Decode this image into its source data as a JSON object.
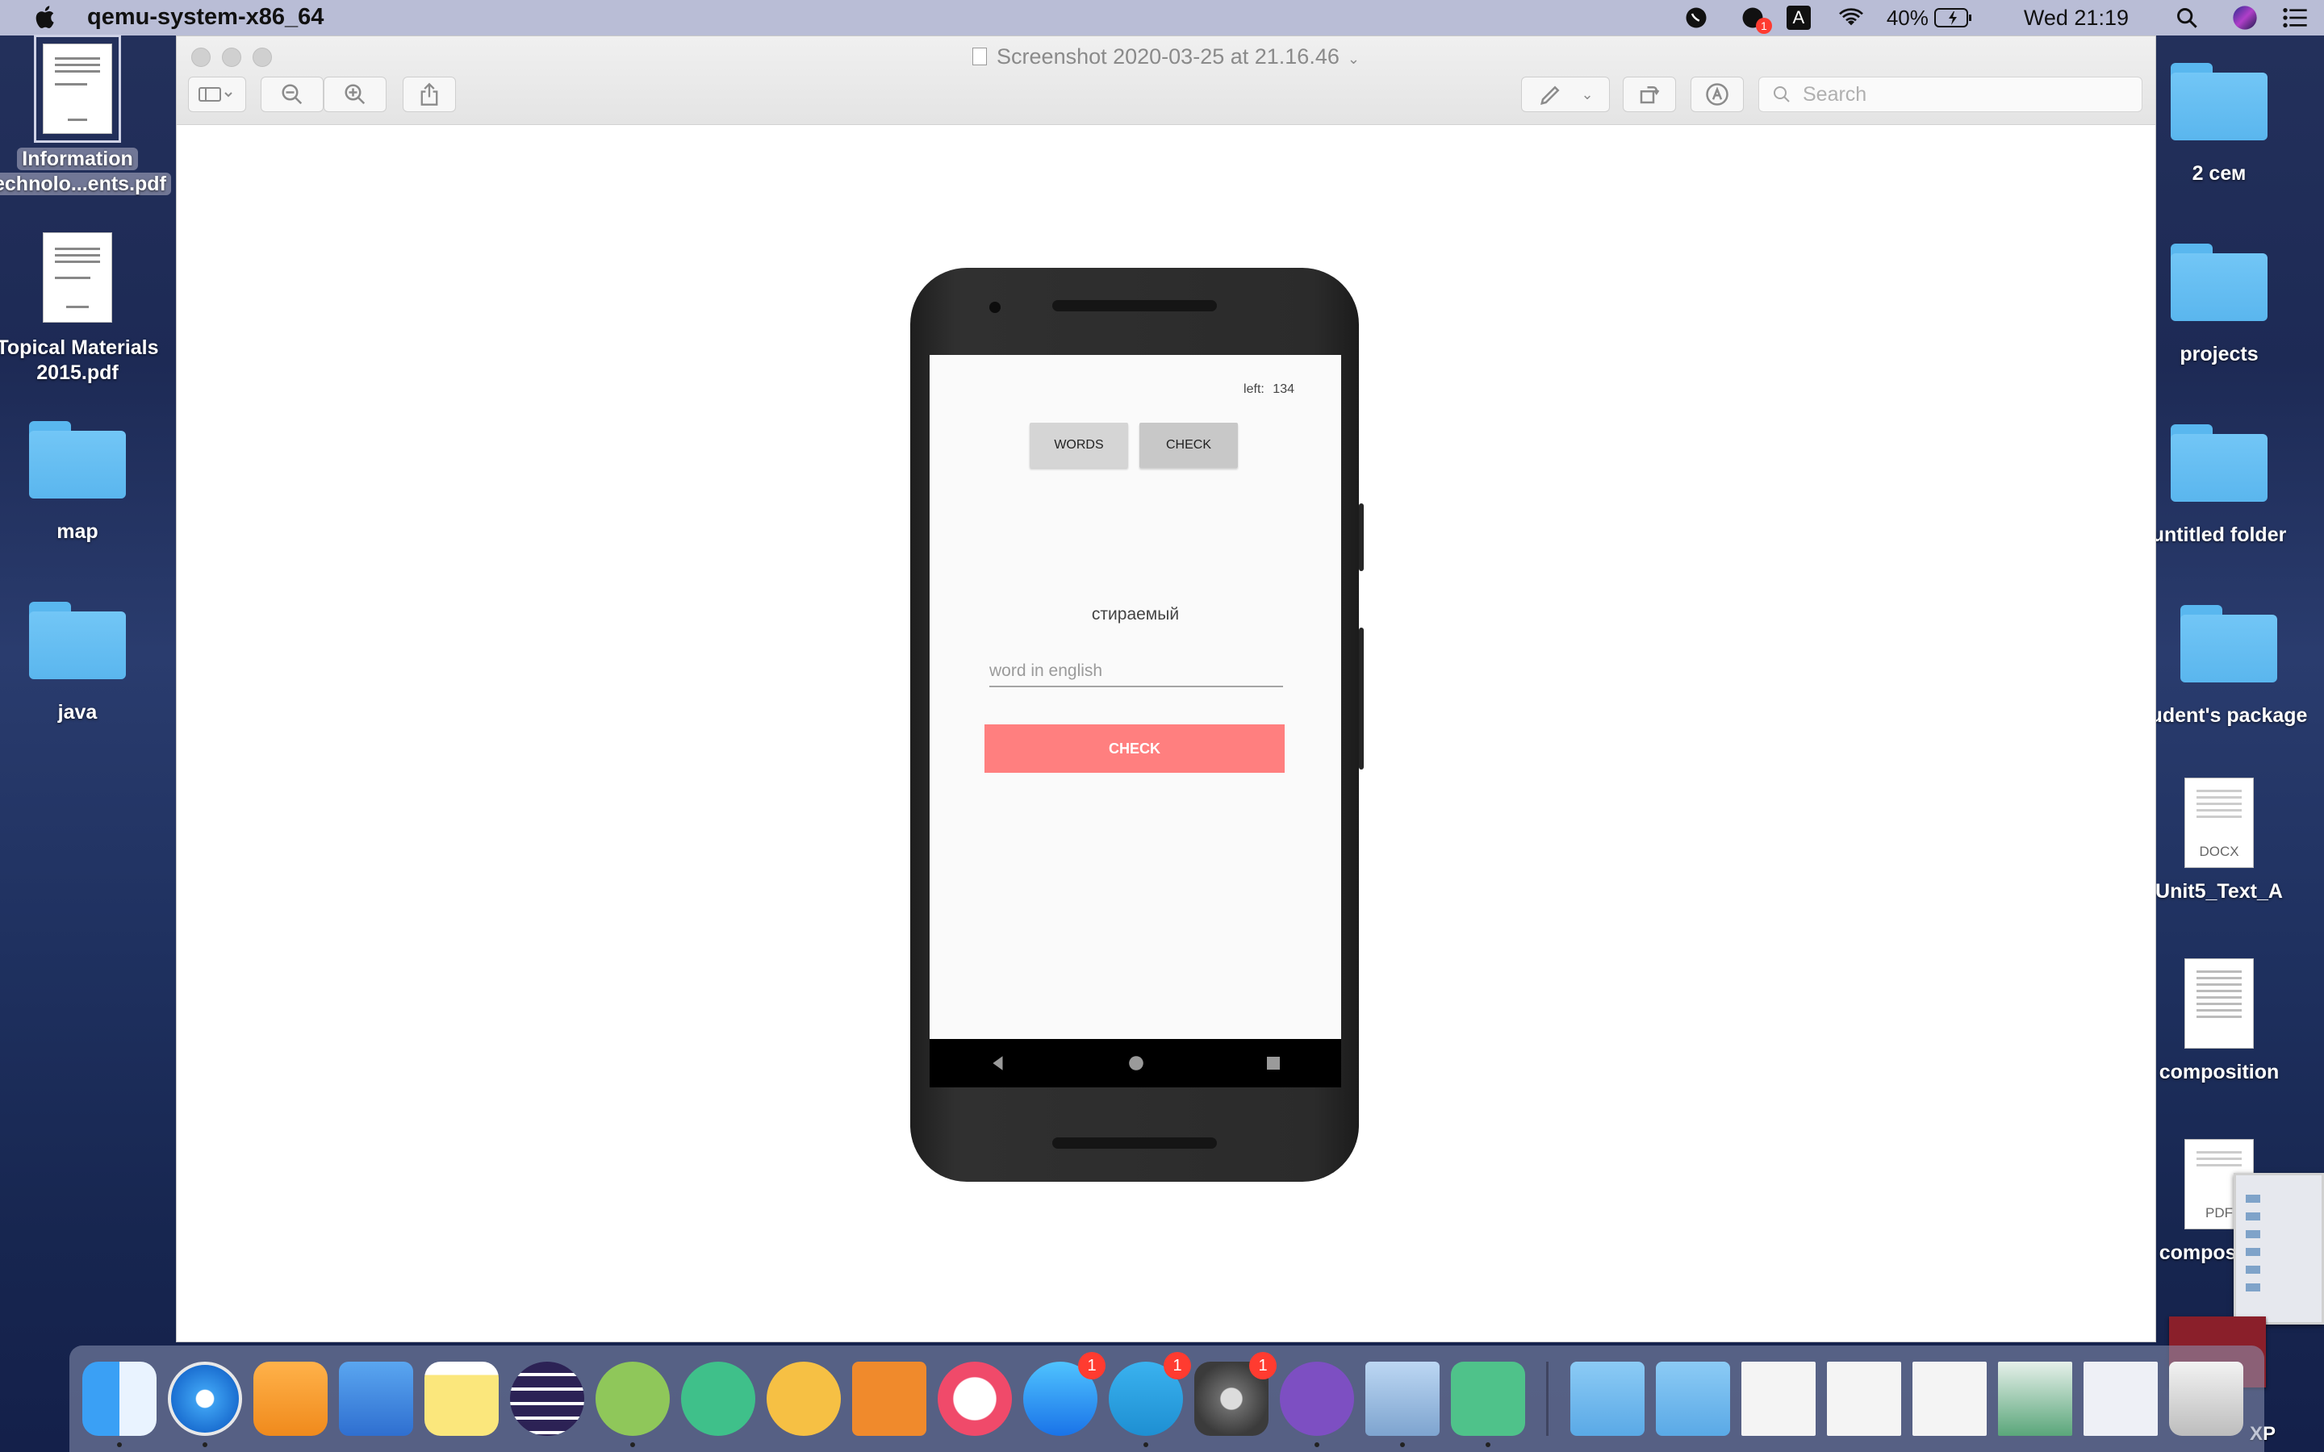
{
  "menubar": {
    "app_name": "qemu-system-x86_64",
    "battery": "40%",
    "clock": "Wed 21:19",
    "status_icons": [
      "viber-icon",
      "notification-badge-icon",
      "input-source-icon",
      "wifi-icon",
      "battery-icon",
      "spotlight-icon",
      "siri-icon",
      "control-center-icon"
    ],
    "notification_count": "1",
    "input_source": "A"
  },
  "window": {
    "title": "Screenshot 2020-03-25 at 21.16.46",
    "search_placeholder": "Search"
  },
  "emulator": {
    "left_label": "left:",
    "left_count": "134",
    "words_button": "WORDS",
    "check_tab_button": "CHECK",
    "word": "стираемый",
    "input_placeholder": "word in english",
    "check_button": "CHECK"
  },
  "desktop_left": [
    {
      "label_line1": "Information",
      "label_line2": "echnolo...ents.pdf",
      "kind": "pdf"
    },
    {
      "label_line1": "Topical Materials",
      "label_line2": "2015.pdf",
      "kind": "pdf"
    },
    {
      "label_line1": "map",
      "label_line2": "",
      "kind": "folder"
    },
    {
      "label_line1": "java",
      "label_line2": "",
      "kind": "folder"
    }
  ],
  "desktop_right": [
    {
      "label": "2 сем",
      "kind": "folder"
    },
    {
      "label": "projects",
      "kind": "folder"
    },
    {
      "label": "untitled folder",
      "kind": "folder"
    },
    {
      "label": "udent's package",
      "kind": "folder"
    },
    {
      "label": "Unit5_Text_A",
      "kind": "docx",
      "ext": "DOCX"
    },
    {
      "label": "composition",
      "kind": "doc"
    },
    {
      "label": "composition",
      "kind": "pdf",
      "ext": "PDF"
    }
  ],
  "desktop_extra_label": "XP",
  "dock": {
    "apps": [
      "finder-icon",
      "safari-icon",
      "pages-icon",
      "keynote-icon",
      "notes-icon",
      "eclipse-icon",
      "android-studio-icon",
      "android-studio-icon",
      "android-studio-icon",
      "sourcetree-icon",
      "music-icon",
      "app-store-icon",
      "telegram-icon",
      "system-preferences-icon",
      "viber-icon",
      "preview-icon",
      "device-icon"
    ],
    "badges": {
      "app_store": "1",
      "telegram": "1",
      "system_preferences": "1"
    },
    "stacks": [
      "downloads-stack-icon",
      "applications-stack-icon",
      "document-thumb-1",
      "document-thumb-2",
      "document-thumb-3",
      "document-thumb-4",
      "document-thumb-5",
      "trash-icon"
    ]
  }
}
